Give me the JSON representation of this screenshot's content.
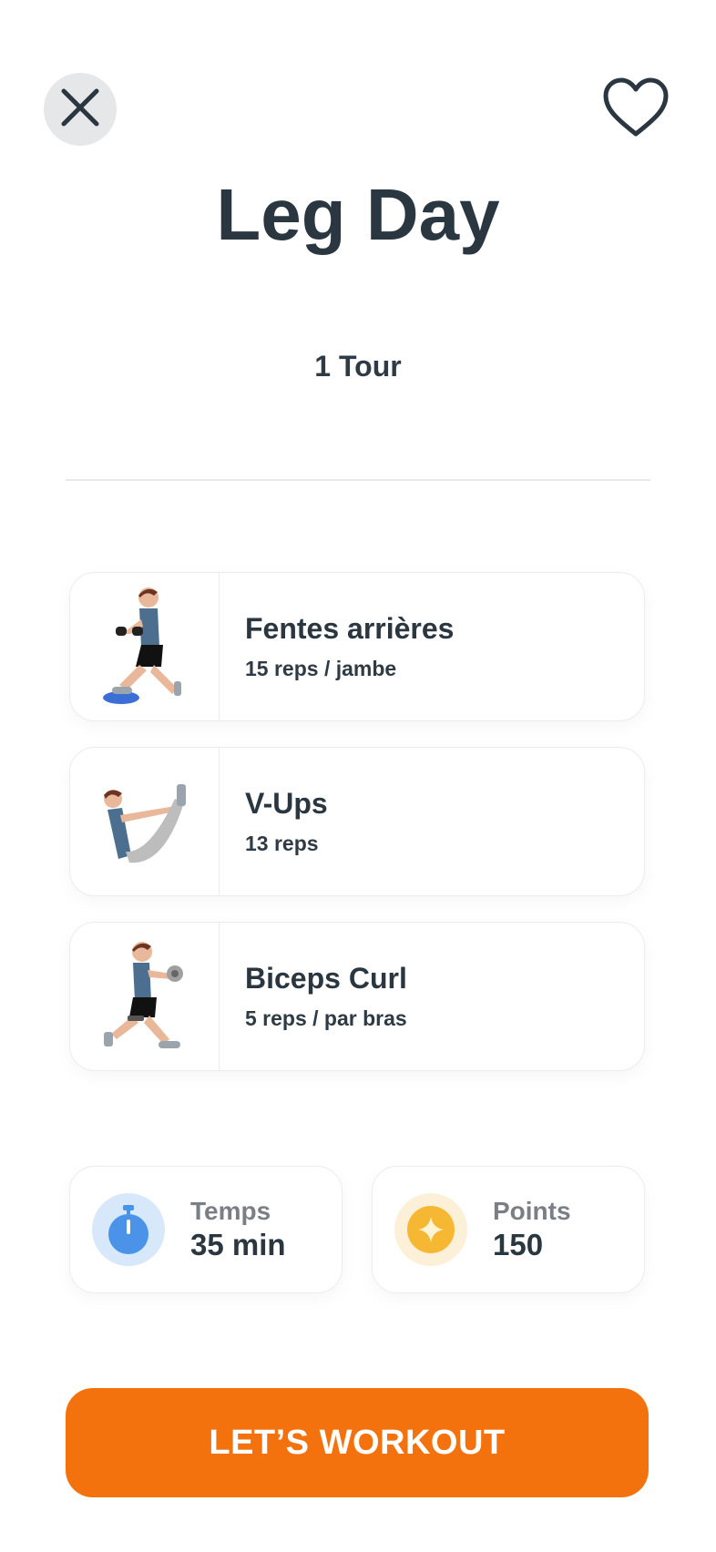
{
  "header": {
    "close_icon": "close-icon",
    "favorite_icon": "heart-outline-icon"
  },
  "workout": {
    "title": "Leg Day",
    "rounds": "1 Tour"
  },
  "exercises": [
    {
      "name": "Fentes arrières",
      "reps": "15 reps / jambe",
      "illustration": "reverse-lunge-dumbbell"
    },
    {
      "name": "V-Ups",
      "reps": "13 reps",
      "illustration": "v-up"
    },
    {
      "name": "Biceps Curl",
      "reps": "5 reps / par bras",
      "illustration": "lunge-biceps-curl"
    }
  ],
  "stats": {
    "time": {
      "label": "Temps",
      "value": "35 min",
      "icon": "stopwatch-icon",
      "color": "#4a93e8"
    },
    "points": {
      "label": "Points",
      "value": "150",
      "icon": "star-coin-icon",
      "color": "#f6b733"
    }
  },
  "cta": {
    "label": "LET’S WORKOUT",
    "color": "#f3720e"
  }
}
